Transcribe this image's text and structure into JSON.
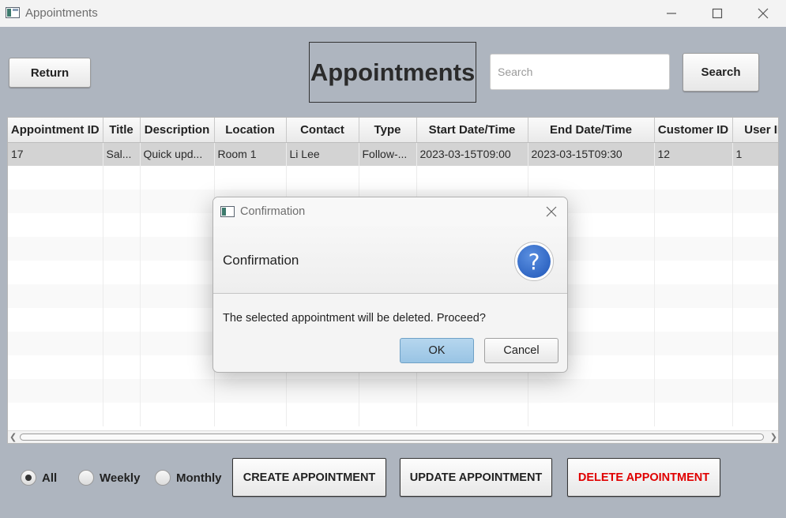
{
  "window": {
    "title": "Appointments",
    "minimize_icon": "minimize-icon",
    "maximize_icon": "maximize-icon",
    "close_icon": "close-icon"
  },
  "header": {
    "return_label": "Return",
    "page_title": "Appointments",
    "search_placeholder": "Search",
    "search_value": "",
    "search_button_label": "Search"
  },
  "table": {
    "columns": [
      "Appointment ID",
      "Title",
      "Description",
      "Location",
      "Contact",
      "Type",
      "Start Date/Time",
      "End Date/Time",
      "Customer ID",
      "User ID"
    ],
    "rows": [
      [
        "17",
        "Sal...",
        "Quick upd...",
        "Room 1",
        "Li Lee",
        "Follow-...",
        "2023-03-15T09:00",
        "2023-03-15T09:30",
        "12",
        "1"
      ]
    ],
    "selected_row": 0
  },
  "filters": {
    "options": [
      {
        "label": "All",
        "selected": true
      },
      {
        "label": "Weekly",
        "selected": false
      },
      {
        "label": "Monthly",
        "selected": false
      }
    ]
  },
  "actions": {
    "create_label": "CREATE APPOINTMENT",
    "update_label": "UPDATE APPOINTMENT",
    "delete_label": "DELETE APPOINTMENT",
    "delete_color": "#e00000"
  },
  "dialog": {
    "window_title": "Confirmation",
    "header_text": "Confirmation",
    "icon": "question-icon",
    "message": "The selected appointment will be deleted. Proceed?",
    "ok_label": "OK",
    "cancel_label": "Cancel"
  }
}
